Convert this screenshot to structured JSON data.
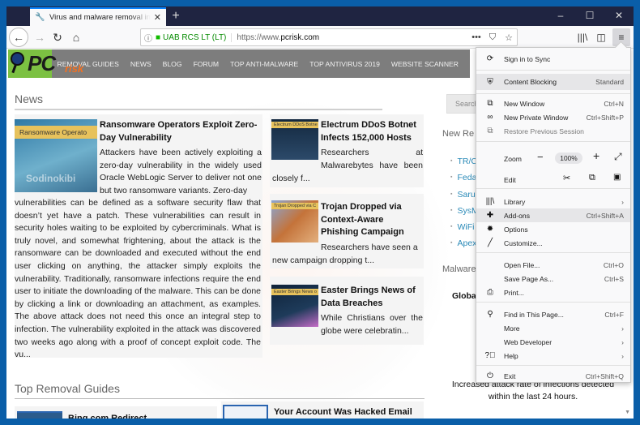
{
  "browser": {
    "tab_title": "Virus and malware removal instructions",
    "tab_favicon": "wrench-icon",
    "new_tab": "+",
    "window_controls": {
      "minimize": "–",
      "maximize": "☐",
      "close": "✕"
    },
    "identity_org": "UAB RCS LT (LT)",
    "url_prefix": "https://www.",
    "url_domain": "pcrisk.com",
    "page_actions": "•••",
    "icons": {
      "back": "←",
      "forward": "→",
      "reload": "↻",
      "home": "⌂",
      "library": "|||\\",
      "sidebar": "◫",
      "menu": "≡",
      "pocket": "⛉",
      "bookmark": "☆",
      "info": "ⓘ",
      "lock": "🔒"
    }
  },
  "site": {
    "logo_pc": "PC",
    "logo_risk": "risk",
    "nav": [
      "REMOVAL GUIDES",
      "NEWS",
      "BLOG",
      "FORUM",
      "TOP ANTI-MALWARE",
      "TOP ANTIVIRUS 2019",
      "WEBSITE SCANNER"
    ],
    "news_heading": "News",
    "main_article": {
      "thumb_label": "Ransomware Operato",
      "thumb_caption": "Sodinokibi",
      "title": "Ransomware Operators Exploit Zero-Day Vulnerability",
      "intro": "Attackers have been actively exploiting a zero-day vulnerability in the widely used Oracle WebLogic Server to deliver not one but two ransomware variants. Zero-day",
      "body": "vulnerabilities can be defined as a software security flaw that doesn’t yet have a patch. These vulnerabilities can result in security holes waiting to be exploited by cybercriminals. What is truly novel, and somewhat frightening, about the attack is the ransomware can be downloaded and executed without the end user clicking on anything, the attacker simply exploits the vulnerability. Traditionally, ransomware infections require the end user to initiate the downloading of the malware. This can be done by clicking a link or downloading an attachment, as examples. The above attack does not need this once an integral step to infection. The vulnerability exploited in the attack was discovered two weeks ago along with a proof of concept exploit code. The vu..."
    },
    "side_articles": [
      {
        "thumb_label": "Electrum DDoS Botne",
        "title": "Electrum DDoS Botnet Infects 152,000 Hosts",
        "intro": "Researchers at Malwarebytes have been",
        "rest": "closely f..."
      },
      {
        "thumb_label": "Trojan Dropped via C",
        "title": "Trojan Dropped via Context-Aware Phishing Campaign",
        "intro": "Researchers have seen a",
        "rest": "new campaign dropping t..."
      },
      {
        "thumb_label": "Easter Brings News o",
        "title": "Easter Brings News of Data Breaches",
        "intro": "While Christians over the globe were celebratin..."
      }
    ],
    "top_removal_heading": "Top Removal Guides",
    "removal_guides": [
      {
        "title": "Bing.com Redirect"
      },
      {
        "title": "Your Account Was Hacked Email Scam"
      }
    ],
    "sidebar": {
      "search_placeholder": "Search",
      "new_removals_heading": "New Re",
      "new_removals": [
        "TR/C",
        "Feda",
        "Saru",
        "SysM",
        "WiFi",
        "Apex"
      ],
      "malware_heading": "Malware",
      "global_label": "Globa",
      "stat_line1": "Increased attack rate of infections detected",
      "stat_line2": "within the last 24 hours."
    }
  },
  "app_menu": {
    "sign_in": "Sign in to Sync",
    "content_blocking": "Content Blocking",
    "content_blocking_value": "Standard",
    "new_window": "New Window",
    "new_window_sc": "Ctrl+N",
    "new_private": "New Private Window",
    "new_private_sc": "Ctrl+Shift+P",
    "restore": "Restore Previous Session",
    "zoom_label": "Zoom",
    "zoom_minus": "−",
    "zoom_value": "100%",
    "zoom_plus": "+",
    "fullscreen": "⤢",
    "edit_label": "Edit",
    "cut": "✂",
    "copy": "⧉",
    "paste": "📋",
    "library": "Library",
    "addons": "Add-ons",
    "addons_sc": "Ctrl+Shift+A",
    "options": "Options",
    "customize": "Customize...",
    "open_file": "Open File...",
    "open_file_sc": "Ctrl+O",
    "save_page": "Save Page As...",
    "save_page_sc": "Ctrl+S",
    "print": "Print...",
    "find": "Find in This Page...",
    "find_sc": "Ctrl+F",
    "more": "More",
    "web_dev": "Web Developer",
    "help": "Help",
    "exit": "Exit",
    "exit_sc": "Ctrl+Shift+Q",
    "arrow": "›"
  }
}
